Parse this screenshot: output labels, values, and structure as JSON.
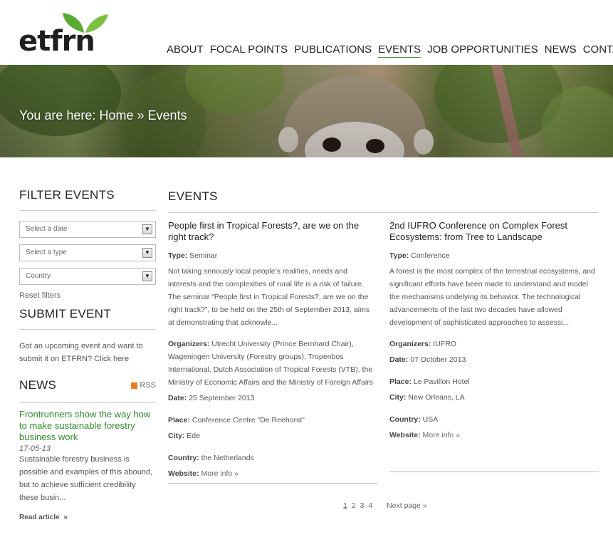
{
  "logo": {
    "text": "etfrn"
  },
  "nav": [
    {
      "label": "ABOUT",
      "active": false
    },
    {
      "label": "FOCAL POINTS",
      "active": false
    },
    {
      "label": "PUBLICATIONS",
      "active": false
    },
    {
      "label": "EVENTS",
      "active": true
    },
    {
      "label": "JOB OPPORTUNITIES",
      "active": false
    },
    {
      "label": "NEWS",
      "active": false
    },
    {
      "label": "CONTACT",
      "active": false
    }
  ],
  "breadcrumb": {
    "prefix": "You are here:",
    "home": "Home",
    "sep": "»",
    "current": "Events"
  },
  "filter": {
    "heading": "FILTER EVENTS",
    "date_placeholder": "Select a date",
    "type_placeholder": "Select a type",
    "country_placeholder": "Country",
    "reset": "Reset filters"
  },
  "submit": {
    "heading": "SUBMIT EVENT",
    "text": "Got an upcoming event and want to submit it on ETFRN?",
    "link": "Click here"
  },
  "news": {
    "heading": "NEWS",
    "rss": "RSS",
    "title": "Frontrunners show the way how to make sustainable forestry business work",
    "date": "17-05-13",
    "body": "Sustainable forestry business is possible and examples of this abound, but to achieve sufficient credibility these busin...",
    "read_more": "Read article",
    "read_more_arrow": "»"
  },
  "main": {
    "heading": "EVENTS"
  },
  "events": [
    {
      "title": "People first in Tropical Forests?, are we on the right track?",
      "type_label": "Type:",
      "type": "Seminar",
      "summary": "Not taking seriously local people’s realities, needs and interests and the complexities of rural life is a risk of failure. The seminar “People first in Tropical Forests?, are we on the right track?”, to be held on the 25th of September 2013, aims at demonstrating that acknowle...",
      "organizers_label": "Organizers:",
      "organizers": "Utrecht University (Prince Bernhard Chair), Wageningen University (Forestry groups), Tropenbos International, Dutch Association of Tropical Forests (VTB), the Ministry of Economic Affairs and the Ministry of Foreign Affairs",
      "date_label": "Date:",
      "date": "25 September 2013",
      "place_label": "Place:",
      "place": "Conference Centre \"De Reehorst\"",
      "city_label": "City:",
      "city": "Ede",
      "country_label": "Country:",
      "country": "the Netherlands",
      "website_label": "Website:",
      "website": "More info »"
    },
    {
      "title": "2nd IUFRO Conference on Complex Forest Ecosystems: from Tree to Landscape",
      "type_label": "Type:",
      "type": "Conference",
      "summary": "A forest is the most complex of the terrestrial ecosystems, and significant efforts have been made to understand and model the mechanisms undelying its behavior. The technological advancements of the last two decades have allowed development of sophisticated approaches to assessi...",
      "organizers_label": "Organizers:",
      "organizers": "IUFRO",
      "date_label": "Date:",
      "date": "07 October 2013",
      "place_label": "Place:",
      "place": "Le Pavillon Hotel",
      "city_label": "City:",
      "city": "New Orleans, LA",
      "country_label": "Country:",
      "country": "USA",
      "website_label": "Website:",
      "website": "More info »"
    }
  ],
  "pager": {
    "pages": [
      "1",
      "2",
      "3",
      "4"
    ],
    "current": "1",
    "next": "Next page »"
  },
  "colors": {
    "accent_green": "#3e8d2a",
    "news_link": "#2e8b2e",
    "rss_orange": "#f27c1d"
  }
}
